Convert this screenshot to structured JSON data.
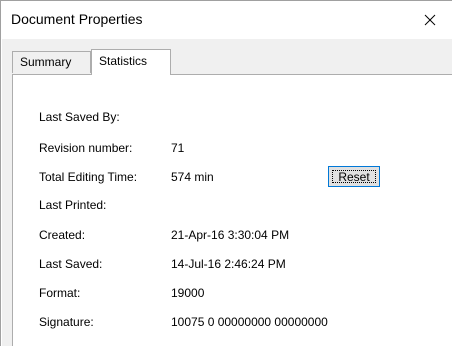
{
  "window": {
    "title": "Document Properties",
    "close_icon": "close-icon"
  },
  "tabs": [
    {
      "label": "Summary",
      "active": false
    },
    {
      "label": "Statistics",
      "active": true
    }
  ],
  "stats": {
    "last_saved_by": {
      "label": "Last Saved By:",
      "value": ""
    },
    "revision_number": {
      "label": "Revision number:",
      "value": "71"
    },
    "total_editing_time": {
      "label": "Total Editing Time:",
      "value": "574 min"
    },
    "last_printed": {
      "label": "Last Printed:",
      "value": ""
    },
    "created": {
      "label": "Created:",
      "value": "21-Apr-16 3:30:04 PM"
    },
    "last_saved": {
      "label": "Last Saved:",
      "value": "14-Jul-16 2:46:24 PM"
    },
    "format": {
      "label": "Format:",
      "value": "19000"
    },
    "signature": {
      "label": "Signature:",
      "value": "10075 0 00000000 00000000"
    }
  },
  "buttons": {
    "reset_label": "Reset"
  },
  "colors": {
    "focus_border": "#0078d7",
    "client_bg": "#f0f0f0",
    "panel_bg": "#ffffff"
  }
}
